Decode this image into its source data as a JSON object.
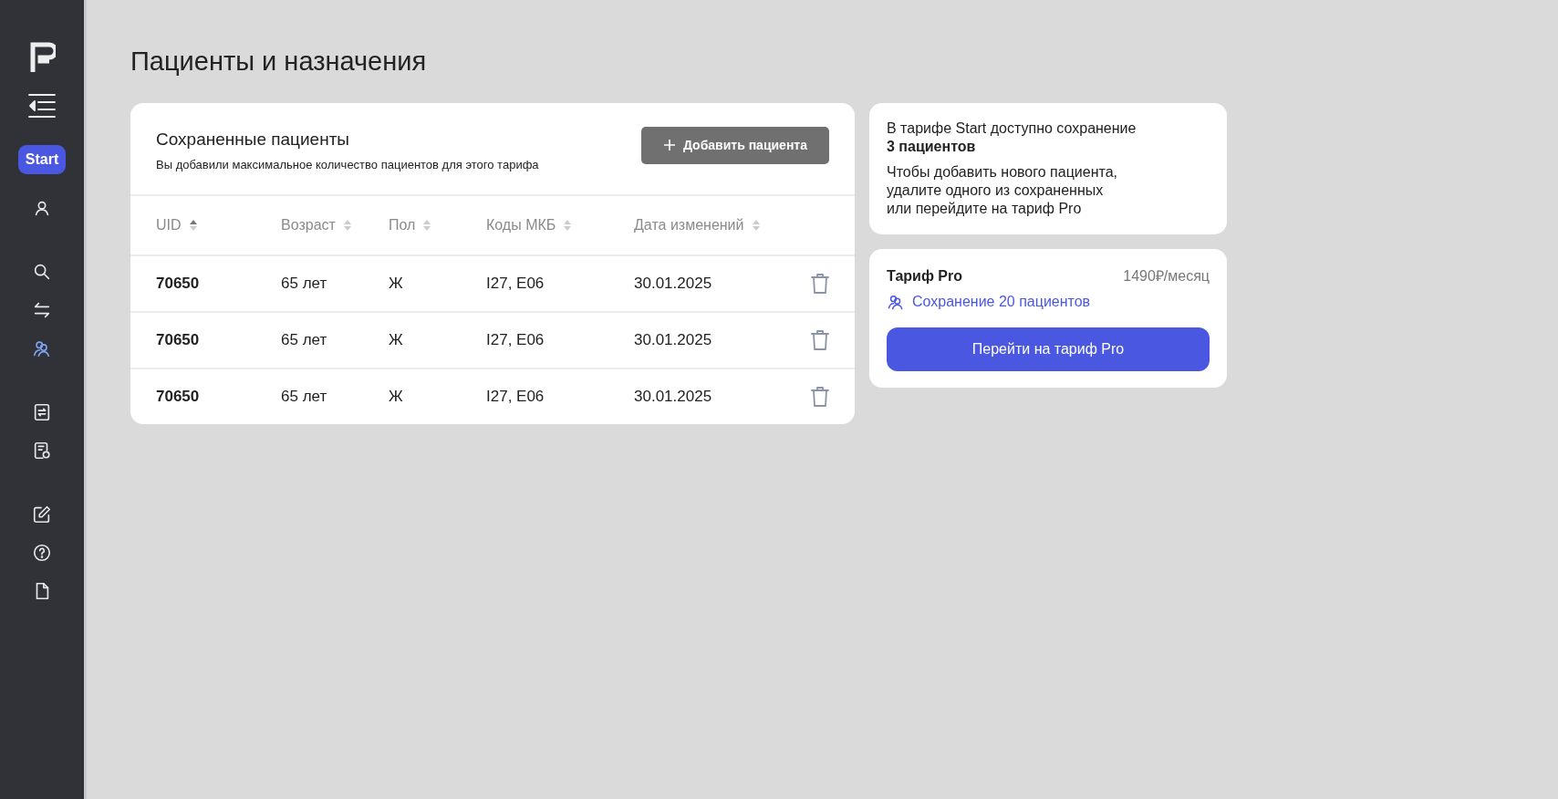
{
  "sidebar": {
    "plan_badge": "Start",
    "groups": [
      {
        "items": [
          {
            "kind": "user",
            "selected": false
          }
        ]
      },
      {
        "items": [
          {
            "kind": "search",
            "selected": false
          },
          {
            "kind": "swap",
            "selected": false
          },
          {
            "kind": "users",
            "selected": true
          }
        ]
      },
      {
        "items": [
          {
            "kind": "exchange-doc",
            "selected": false
          },
          {
            "kind": "doc-refresh",
            "selected": false
          }
        ]
      },
      {
        "items": [
          {
            "kind": "edit",
            "selected": false
          },
          {
            "kind": "help",
            "selected": false
          },
          {
            "kind": "file",
            "selected": false
          }
        ]
      }
    ]
  },
  "page_title": "Пациенты и назначения",
  "patients": {
    "title": "Сохраненные пациенты",
    "subtitle": "Вы добавили максимальное количество пациентов для этого тарифа",
    "add_button": {
      "label": "Добавить пациента",
      "disabled": true
    },
    "columns": [
      {
        "label": "UID",
        "sorted": true
      },
      {
        "label": "Возраст",
        "sorted": false
      },
      {
        "label": "Пол",
        "sorted": false
      },
      {
        "label": "Коды МКБ",
        "sorted": false
      },
      {
        "label": "Дата изменений",
        "sorted": false
      }
    ],
    "rows": [
      {
        "uid": "70650",
        "age": "65 лет",
        "sex": "Ж",
        "icd": "I27, E06",
        "date": "30.01.2025"
      },
      {
        "uid": "70650",
        "age": "65 лет",
        "sex": "Ж",
        "icd": "I27, E06",
        "date": "30.01.2025"
      },
      {
        "uid": "70650",
        "age": "65 лет",
        "sex": "Ж",
        "icd": "I27, E06",
        "date": "30.01.2025"
      }
    ]
  },
  "limit_notice": {
    "text": "В тарифе Start доступно сохранение\n**3 пациентов**",
    "hint": "Чтобы добавить нового пациента,\nудалите одного из сохраненных\nили перейдите на тариф Pro"
  },
  "pro_plan": {
    "name": "Тариф Pro",
    "price": "1490₽/месяц",
    "feature": "Сохранение 20 пациентов",
    "button": "Перейти на тариф Pro"
  }
}
